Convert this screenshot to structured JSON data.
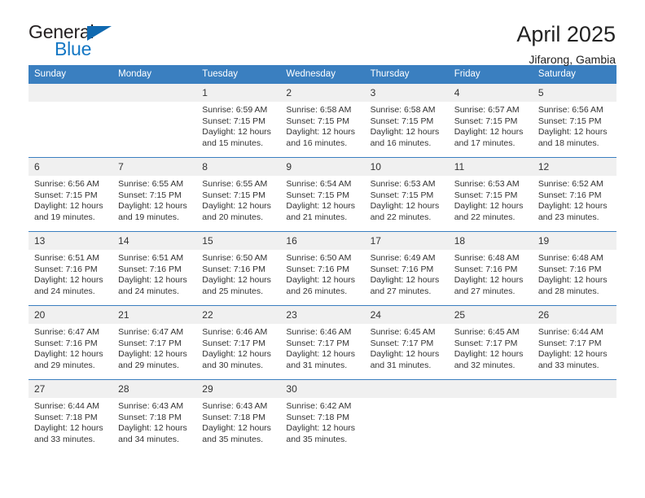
{
  "brand": {
    "name_part1": "General",
    "name_part2": "Blue",
    "accent_color": "#1477c4",
    "triangle_color": "#1069b0"
  },
  "header": {
    "title": "April 2025",
    "subtitle": "Jifarong, Gambia"
  },
  "calendar": {
    "header_bg": "#3a7fc0",
    "daynum_bg": "#f0f0f0",
    "weekdays": [
      "Sunday",
      "Monday",
      "Tuesday",
      "Wednesday",
      "Thursday",
      "Friday",
      "Saturday"
    ],
    "weeks": [
      [
        {
          "day": "",
          "empty": true
        },
        {
          "day": "",
          "empty": true
        },
        {
          "day": "1",
          "sunrise": "Sunrise: 6:59 AM",
          "sunset": "Sunset: 7:15 PM",
          "daylight": "Daylight: 12 hours and 15 minutes."
        },
        {
          "day": "2",
          "sunrise": "Sunrise: 6:58 AM",
          "sunset": "Sunset: 7:15 PM",
          "daylight": "Daylight: 12 hours and 16 minutes."
        },
        {
          "day": "3",
          "sunrise": "Sunrise: 6:58 AM",
          "sunset": "Sunset: 7:15 PM",
          "daylight": "Daylight: 12 hours and 16 minutes."
        },
        {
          "day": "4",
          "sunrise": "Sunrise: 6:57 AM",
          "sunset": "Sunset: 7:15 PM",
          "daylight": "Daylight: 12 hours and 17 minutes."
        },
        {
          "day": "5",
          "sunrise": "Sunrise: 6:56 AM",
          "sunset": "Sunset: 7:15 PM",
          "daylight": "Daylight: 12 hours and 18 minutes."
        }
      ],
      [
        {
          "day": "6",
          "sunrise": "Sunrise: 6:56 AM",
          "sunset": "Sunset: 7:15 PM",
          "daylight": "Daylight: 12 hours and 19 minutes."
        },
        {
          "day": "7",
          "sunrise": "Sunrise: 6:55 AM",
          "sunset": "Sunset: 7:15 PM",
          "daylight": "Daylight: 12 hours and 19 minutes."
        },
        {
          "day": "8",
          "sunrise": "Sunrise: 6:55 AM",
          "sunset": "Sunset: 7:15 PM",
          "daylight": "Daylight: 12 hours and 20 minutes."
        },
        {
          "day": "9",
          "sunrise": "Sunrise: 6:54 AM",
          "sunset": "Sunset: 7:15 PM",
          "daylight": "Daylight: 12 hours and 21 minutes."
        },
        {
          "day": "10",
          "sunrise": "Sunrise: 6:53 AM",
          "sunset": "Sunset: 7:15 PM",
          "daylight": "Daylight: 12 hours and 22 minutes."
        },
        {
          "day": "11",
          "sunrise": "Sunrise: 6:53 AM",
          "sunset": "Sunset: 7:15 PM",
          "daylight": "Daylight: 12 hours and 22 minutes."
        },
        {
          "day": "12",
          "sunrise": "Sunrise: 6:52 AM",
          "sunset": "Sunset: 7:16 PM",
          "daylight": "Daylight: 12 hours and 23 minutes."
        }
      ],
      [
        {
          "day": "13",
          "sunrise": "Sunrise: 6:51 AM",
          "sunset": "Sunset: 7:16 PM",
          "daylight": "Daylight: 12 hours and 24 minutes."
        },
        {
          "day": "14",
          "sunrise": "Sunrise: 6:51 AM",
          "sunset": "Sunset: 7:16 PM",
          "daylight": "Daylight: 12 hours and 24 minutes."
        },
        {
          "day": "15",
          "sunrise": "Sunrise: 6:50 AM",
          "sunset": "Sunset: 7:16 PM",
          "daylight": "Daylight: 12 hours and 25 minutes."
        },
        {
          "day": "16",
          "sunrise": "Sunrise: 6:50 AM",
          "sunset": "Sunset: 7:16 PM",
          "daylight": "Daylight: 12 hours and 26 minutes."
        },
        {
          "day": "17",
          "sunrise": "Sunrise: 6:49 AM",
          "sunset": "Sunset: 7:16 PM",
          "daylight": "Daylight: 12 hours and 27 minutes."
        },
        {
          "day": "18",
          "sunrise": "Sunrise: 6:48 AM",
          "sunset": "Sunset: 7:16 PM",
          "daylight": "Daylight: 12 hours and 27 minutes."
        },
        {
          "day": "19",
          "sunrise": "Sunrise: 6:48 AM",
          "sunset": "Sunset: 7:16 PM",
          "daylight": "Daylight: 12 hours and 28 minutes."
        }
      ],
      [
        {
          "day": "20",
          "sunrise": "Sunrise: 6:47 AM",
          "sunset": "Sunset: 7:16 PM",
          "daylight": "Daylight: 12 hours and 29 minutes."
        },
        {
          "day": "21",
          "sunrise": "Sunrise: 6:47 AM",
          "sunset": "Sunset: 7:17 PM",
          "daylight": "Daylight: 12 hours and 29 minutes."
        },
        {
          "day": "22",
          "sunrise": "Sunrise: 6:46 AM",
          "sunset": "Sunset: 7:17 PM",
          "daylight": "Daylight: 12 hours and 30 minutes."
        },
        {
          "day": "23",
          "sunrise": "Sunrise: 6:46 AM",
          "sunset": "Sunset: 7:17 PM",
          "daylight": "Daylight: 12 hours and 31 minutes."
        },
        {
          "day": "24",
          "sunrise": "Sunrise: 6:45 AM",
          "sunset": "Sunset: 7:17 PM",
          "daylight": "Daylight: 12 hours and 31 minutes."
        },
        {
          "day": "25",
          "sunrise": "Sunrise: 6:45 AM",
          "sunset": "Sunset: 7:17 PM",
          "daylight": "Daylight: 12 hours and 32 minutes."
        },
        {
          "day": "26",
          "sunrise": "Sunrise: 6:44 AM",
          "sunset": "Sunset: 7:17 PM",
          "daylight": "Daylight: 12 hours and 33 minutes."
        }
      ],
      [
        {
          "day": "27",
          "sunrise": "Sunrise: 6:44 AM",
          "sunset": "Sunset: 7:18 PM",
          "daylight": "Daylight: 12 hours and 33 minutes."
        },
        {
          "day": "28",
          "sunrise": "Sunrise: 6:43 AM",
          "sunset": "Sunset: 7:18 PM",
          "daylight": "Daylight: 12 hours and 34 minutes."
        },
        {
          "day": "29",
          "sunrise": "Sunrise: 6:43 AM",
          "sunset": "Sunset: 7:18 PM",
          "daylight": "Daylight: 12 hours and 35 minutes."
        },
        {
          "day": "30",
          "sunrise": "Sunrise: 6:42 AM",
          "sunset": "Sunset: 7:18 PM",
          "daylight": "Daylight: 12 hours and 35 minutes."
        },
        {
          "day": "",
          "empty": true
        },
        {
          "day": "",
          "empty": true
        },
        {
          "day": "",
          "empty": true
        }
      ]
    ]
  }
}
